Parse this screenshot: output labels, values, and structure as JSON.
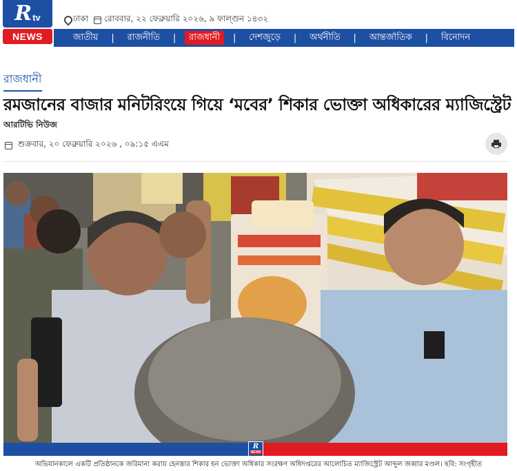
{
  "brand": {
    "logo_letter": "R",
    "logo_suffix": "tv",
    "logo_news": "NEWS"
  },
  "topbar": {
    "location": "ঢাকা",
    "date": "রোববার, ২২ ফেব্রুয়ারি ২০২৬, ৯ ফাল্গুন ১৪৩২"
  },
  "nav": {
    "items": [
      {
        "label": "জাতীয়"
      },
      {
        "label": "রাজনীতি"
      },
      {
        "label": "রাজধানী",
        "active": true
      },
      {
        "label": "দেশজুড়ে"
      },
      {
        "label": "অর্থনীতি"
      },
      {
        "label": "আন্তর্জাতিক"
      },
      {
        "label": "বিনোদন"
      }
    ],
    "separator": "|"
  },
  "article": {
    "category": "রাজধানী",
    "headline": "রমজানের বাজার মনিটরিংয়ে গিয়ে ‘মবের’ শিকার ভোক্তা অধিকারের ম্যাজিস্ট্রেট",
    "author": "আরটিভি নিউজ",
    "published": "শুক্রবার, ২০ ফেব্রুয়ারি ২০২৬ , ০৯:১৫ এএম",
    "photo_caption": "অভিযানকালে একটি প্রতিষ্ঠানকে জরিমানা করায় হেনস্তার শিকার হন ভোক্তা অধিকার সংরক্ষণ অধিদপ্তরের আলোচিত ম্যাজিস্ট্রেট আব্দুল জব্বার মণ্ডল। ছবি: সংগৃহীত",
    "photo_watermark": {
      "letter": "R",
      "news": "NEWS"
    }
  },
  "colors": {
    "brand_blue": "#1d4fa3",
    "brand_red": "#e11b22"
  },
  "icons": [
    "location-pin-icon",
    "calendar-icon",
    "printer-icon"
  ]
}
